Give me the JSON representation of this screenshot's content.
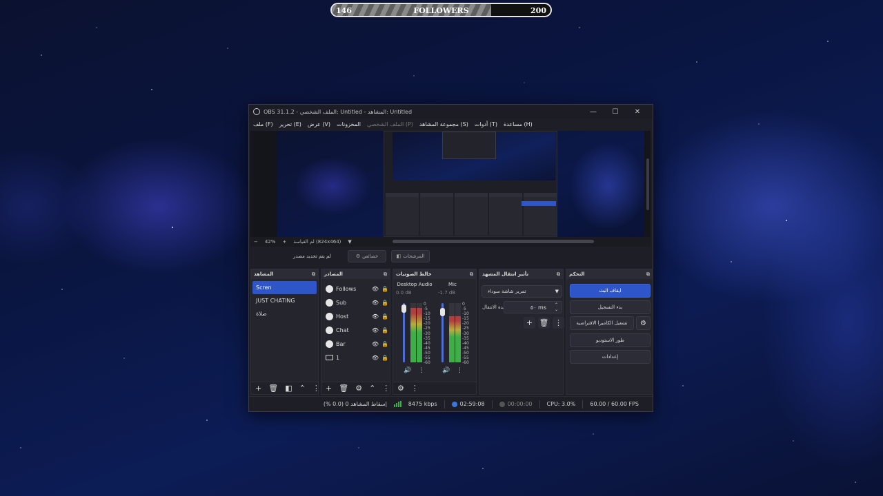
{
  "followers": {
    "current": "146",
    "label": "FOLLOWERS",
    "goal": "200",
    "progress_fraction": 0.73
  },
  "window": {
    "title": "OBS 31.1.2 - الملف الشخصي: Untitled - المشاهد: Untitled",
    "minimize": "—",
    "maximize": "☐",
    "close": "✕"
  },
  "menu": {
    "file": "ملف (F)",
    "edit": "تحرير (E)",
    "view": "عرض (V)",
    "docks": "المخزونات",
    "profile": "الملف الشخصي (P)",
    "scene_collection": "مجموعة المشاهد (S)",
    "tools": "أدوات (T)",
    "help": "مساعدة (H)"
  },
  "zoom": {
    "minus": "−",
    "value": "42%",
    "plus": "+",
    "scale_text": "لم القياسة (824x464)",
    "dropdown": "▼"
  },
  "source_bar": {
    "no_source": "لم يتم تحديد مصدر",
    "properties": "خصائص",
    "filters": "المرشحات"
  },
  "scenes": {
    "title": "المشاهد",
    "items": [
      "Scren",
      "JUST CHATING",
      "صلاة"
    ]
  },
  "sources": {
    "title": "المصادر",
    "items": [
      {
        "label": "Follows",
        "icon": "globe-icon"
      },
      {
        "label": "Sub",
        "icon": "globe-icon"
      },
      {
        "label": "Host",
        "icon": "globe-icon"
      },
      {
        "label": "Chat",
        "icon": "globe-icon"
      },
      {
        "label": "Bar",
        "icon": "globe-icon"
      },
      {
        "label": "1",
        "icon": "monitor-icon"
      }
    ]
  },
  "mixer": {
    "title": "خالط الصوتيات",
    "channels": [
      {
        "name": "Desktop Audio",
        "db": "0.0 dB",
        "level": 0.92
      },
      {
        "name": "Mic",
        "db": "-1.7 dB",
        "level": 0.78
      }
    ],
    "scale": [
      "0",
      "-5",
      "-10",
      "-15",
      "-20",
      "-25",
      "-30",
      "-35",
      "-40",
      "-45",
      "-50",
      "-55",
      "-60"
    ]
  },
  "transitions": {
    "title": "تأثير انتقال المشهد",
    "selected": "تمرير شاشة سوداء",
    "duration_label": "مدة الانتقال",
    "duration_value": "٥٠ ms"
  },
  "controls": {
    "title": "التحكم",
    "stop_stream": "ايقاف البث",
    "start_recording": "بدء التسجيل",
    "virtual_camera": "تشغيل الكاميرا الافتراضية",
    "studio_mode": "طور الاستوديو",
    "settings": "إعدادات"
  },
  "status": {
    "dropped_frames": "إسقاط المشاهد 0 (0.0 %)",
    "bitrate": "8475 kbps",
    "stream_time": "02:59:08",
    "record_time": "00:00:00",
    "cpu": "CPU: 3.0%",
    "fps": "60.00 / 60.00 FPS"
  },
  "colors": {
    "accent": "#2e56c8",
    "meter_green": "#3fae49",
    "meter_red": "#b04040"
  }
}
